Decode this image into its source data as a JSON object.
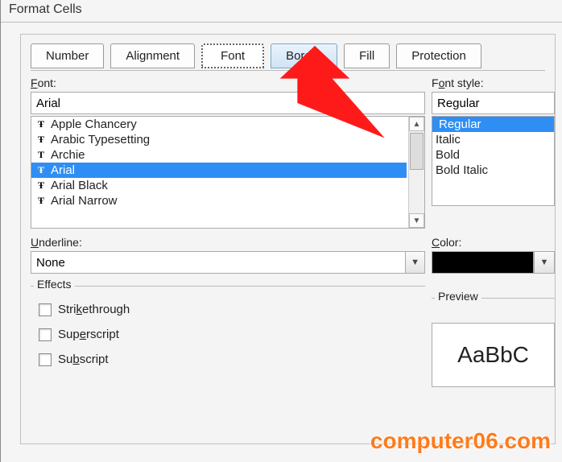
{
  "window": {
    "title": "Format Cells"
  },
  "tabs": {
    "items": [
      "Number",
      "Alignment",
      "Font",
      "Border",
      "Fill",
      "Protection"
    ],
    "active_index": 2,
    "hover_index": 3
  },
  "font": {
    "label": "Font:",
    "value": "Arial",
    "list": [
      "Apple Chancery",
      "Arabic Typesetting",
      "Archie",
      "Arial",
      "Arial Black",
      "Arial Narrow"
    ],
    "selected_index": 3
  },
  "font_style": {
    "label": "Font style:",
    "value": "Regular",
    "list": [
      "Regular",
      "Italic",
      "Bold",
      "Bold Italic"
    ],
    "selected_index": 0
  },
  "underline": {
    "label": "Underline:",
    "value": "None"
  },
  "color": {
    "label": "Color:",
    "swatch": "#000000"
  },
  "effects": {
    "title": "Effects",
    "items": [
      "Strikethrough",
      "Superscript",
      "Subscript"
    ]
  },
  "preview": {
    "title": "Preview",
    "sample": "AaBbC"
  },
  "watermark": "computer06.com"
}
